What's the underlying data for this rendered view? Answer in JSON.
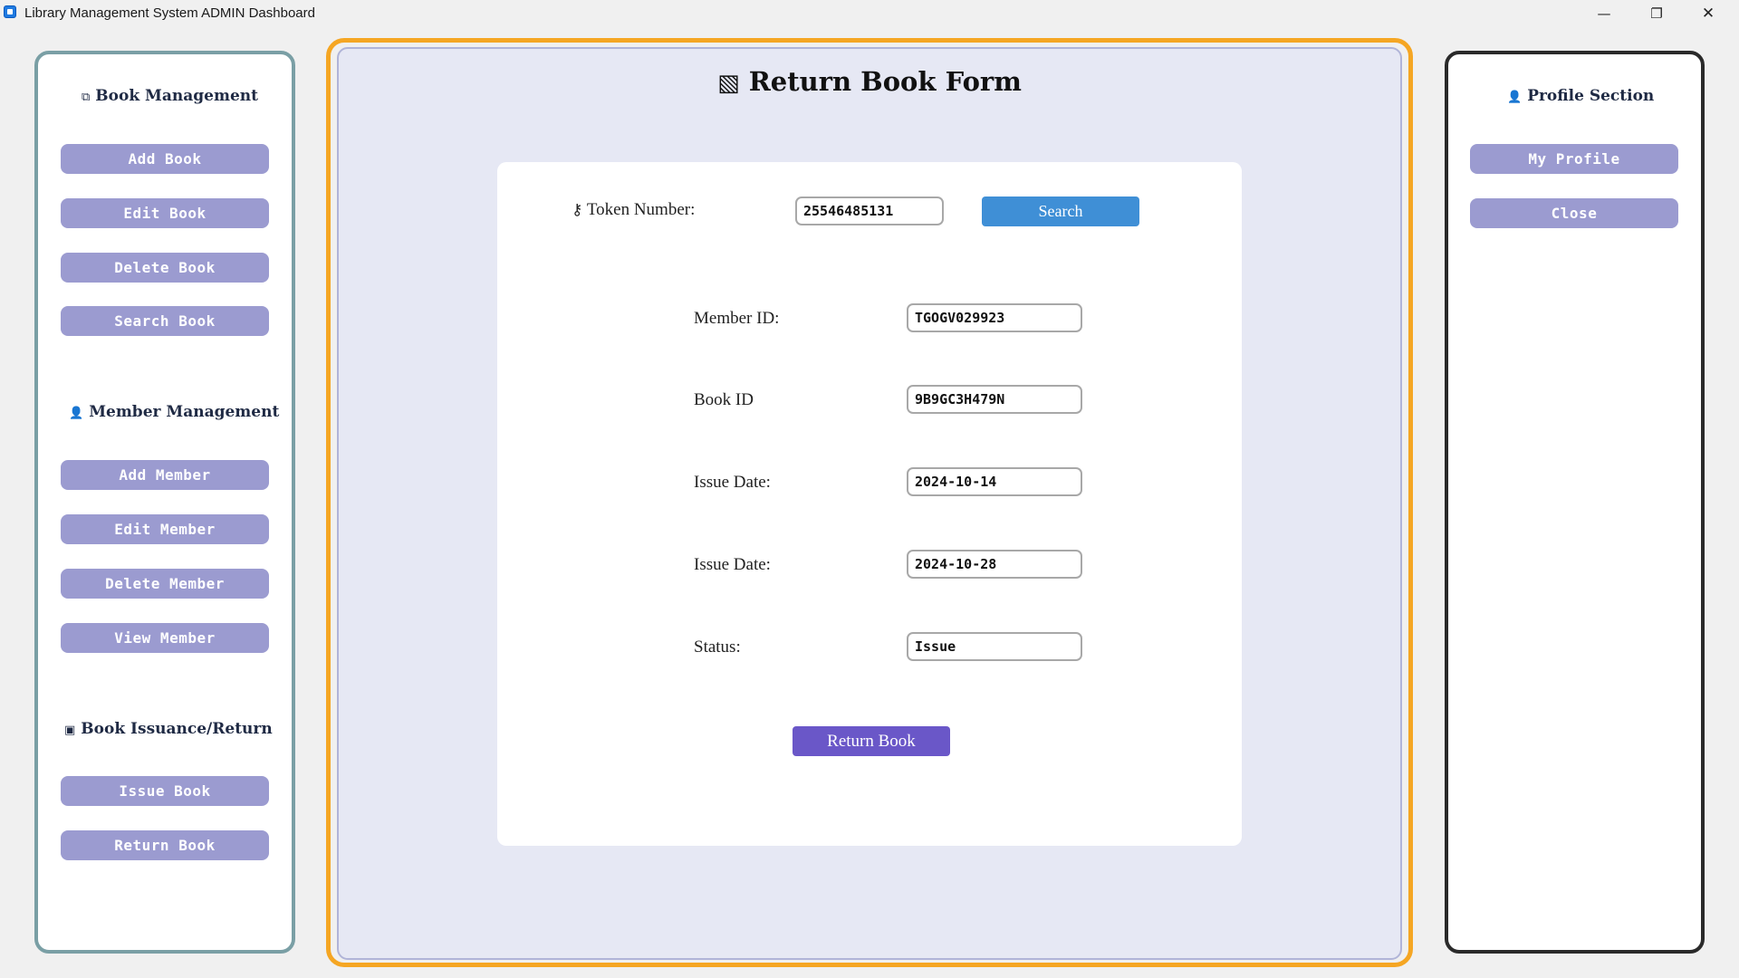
{
  "window": {
    "title": "Library Management System ADMIN Dashboard",
    "minimize_glyph": "—",
    "maximize_glyph": "❐",
    "close_glyph": "✕"
  },
  "sidebar": {
    "book_management": {
      "icon": "books-icon",
      "icon_glyph": "⧉",
      "title": "Book Management",
      "buttons": [
        "Add Book",
        "Edit Book",
        "Delete Book",
        "Search Book"
      ]
    },
    "member_management": {
      "icon": "person-icon",
      "icon_glyph": "👤",
      "title": "Member Management",
      "buttons": [
        "Add Member",
        "Edit Member",
        "Delete Member",
        "View Member"
      ]
    },
    "issuance": {
      "icon": "ledger-icon",
      "icon_glyph": "▣",
      "title": "Book Issuance/Return",
      "buttons": [
        "Issue Book",
        "Return Book"
      ]
    }
  },
  "profile": {
    "icon": "person-icon",
    "icon_glyph": "👤",
    "title": "Profile Section",
    "buttons": [
      "My Profile",
      "Close"
    ]
  },
  "form": {
    "title": "Return Book Form",
    "title_icon": "notebook-icon",
    "title_icon_glyph": "▧",
    "token": {
      "icon": "key-icon",
      "icon_glyph": "⚷",
      "label": "Token Number:",
      "value": "25546485131"
    },
    "search_label": "Search",
    "fields": [
      {
        "label": "Member ID:",
        "value": "TGOGV029923"
      },
      {
        "label": "Book ID",
        "value": "9B9GC3H479N"
      },
      {
        "label": "Issue Date:",
        "value": "2024-10-14"
      },
      {
        "label": "Issue Date:",
        "value": "2024-10-28"
      },
      {
        "label": "Status:",
        "value": "Issue"
      }
    ],
    "return_label": "Return Book"
  }
}
